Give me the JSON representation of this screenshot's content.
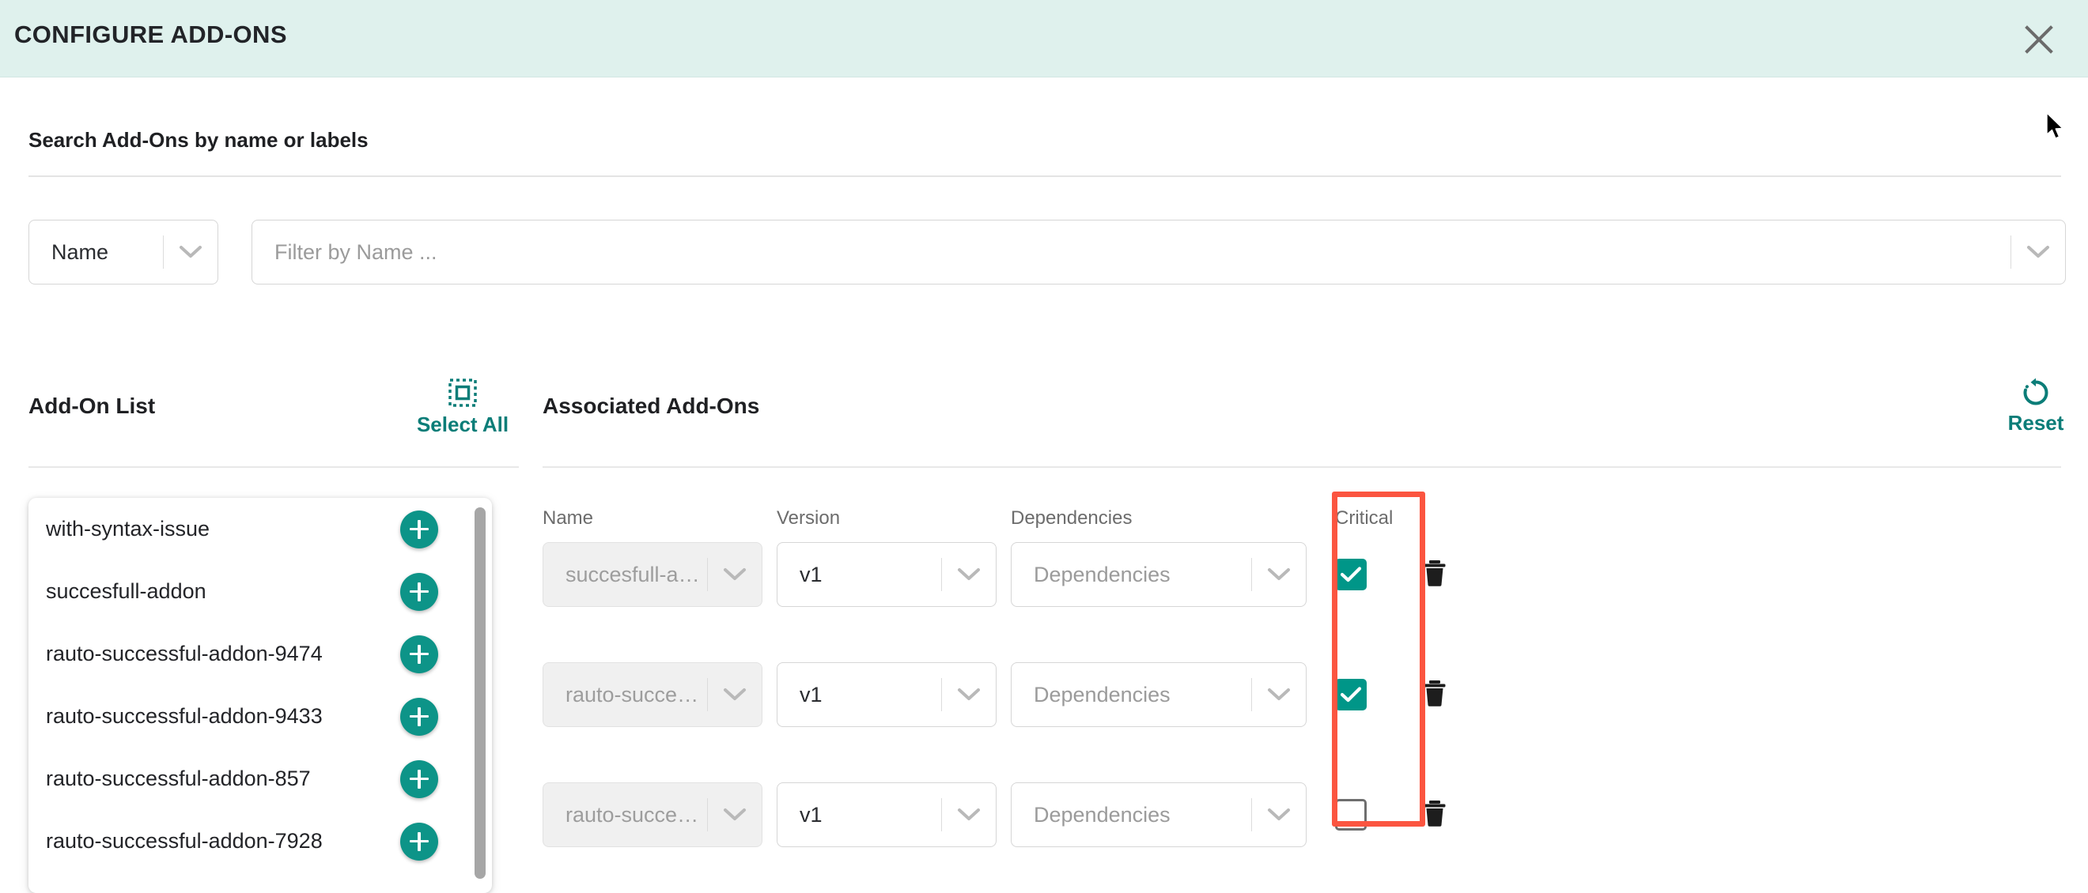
{
  "header": {
    "title": "CONFIGURE ADD-ONS",
    "close_icon": "close-icon"
  },
  "search": {
    "label": "Search Add-Ons by name or labels",
    "type_select": {
      "value": "Name",
      "chevron_icon": "chevron-down-icon"
    },
    "filter_input": {
      "placeholder": "Filter by Name ...",
      "value": "",
      "chevron_icon": "chevron-down-icon"
    }
  },
  "left_panel": {
    "title": "Add-On List",
    "select_all": {
      "label": "Select All",
      "icon": "select-all-icon"
    },
    "items": [
      {
        "name": "with-syntax-issue",
        "add_icon": "plus-icon"
      },
      {
        "name": "succesfull-addon",
        "add_icon": "plus-icon"
      },
      {
        "name": "rauto-successful-addon-9474",
        "add_icon": "plus-icon"
      },
      {
        "name": "rauto-successful-addon-9433",
        "add_icon": "plus-icon"
      },
      {
        "name": "rauto-successful-addon-857",
        "add_icon": "plus-icon"
      },
      {
        "name": "rauto-successful-addon-7928",
        "add_icon": "plus-icon"
      }
    ]
  },
  "right_panel": {
    "title": "Associated Add-Ons",
    "reset": {
      "label": "Reset",
      "icon": "restore-icon"
    },
    "columns": {
      "name": "Name",
      "version": "Version",
      "dependencies": "Dependencies",
      "critical": "Critical"
    },
    "rows": [
      {
        "name": "succesfull-addon",
        "version": "v1",
        "dependencies_placeholder": "Dependencies",
        "critical": true,
        "delete_icon": "trash-icon"
      },
      {
        "name": "rauto-successful-addon-...",
        "version": "v1",
        "dependencies_placeholder": "Dependencies",
        "critical": true,
        "delete_icon": "trash-icon"
      },
      {
        "name": "rauto-successful-addon-...",
        "version": "v1",
        "dependencies_placeholder": "Dependencies",
        "critical": false,
        "delete_icon": "trash-icon"
      }
    ]
  },
  "colors": {
    "header_background": "#dff1ed",
    "accent_teal": "#0b7d78",
    "fab_teal": "#0d9488",
    "checkbox_teal": "#009688",
    "annotation_red": "#fb5540"
  }
}
